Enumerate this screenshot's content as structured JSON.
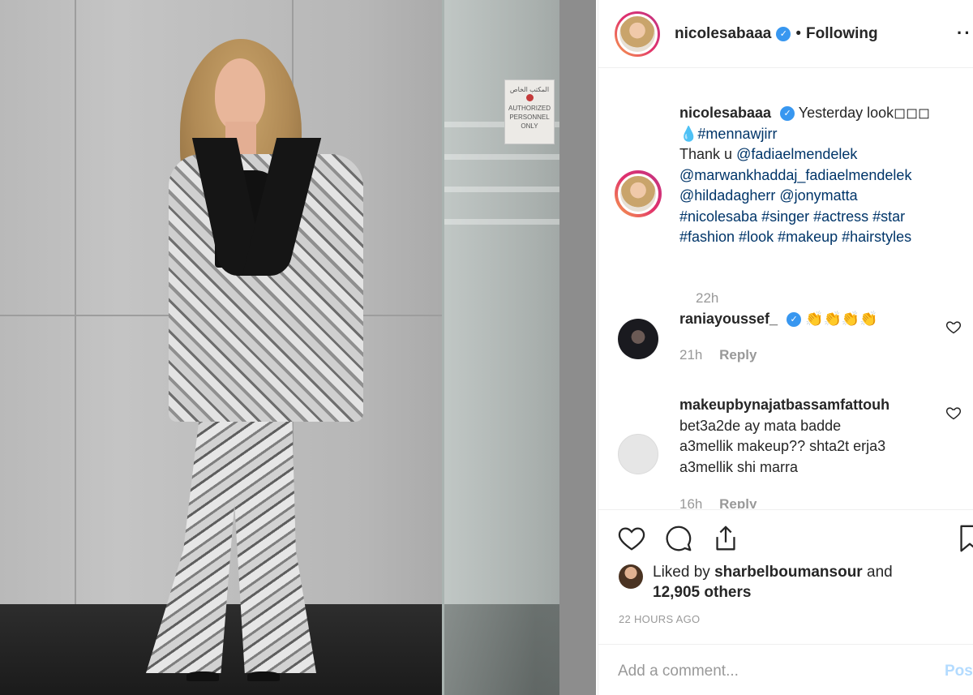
{
  "post": {
    "username": "nicolesabaaa",
    "verified_mark": "✓",
    "separator": "•",
    "follow_status": "Following",
    "more_icon": "···"
  },
  "caption": {
    "username": "nicolesabaaa",
    "line1": "Yesterday look◻◻◻",
    "line2_emoji": "💧",
    "line2_tag": "#mennawjirr",
    "thank": "Thank u",
    "mention1": "@fadiaelmendelek",
    "mention2": "@marwankhaddaj_fadiaelmendelek",
    "mention3": "@hildadagherr",
    "mention4": "@jonymatta",
    "tags1": "#nicolesaba #singer #actress #star",
    "tags2": "#fashion #look #makeup #hairstyles",
    "time": "22h"
  },
  "comments": [
    {
      "username": "raniayoussef_",
      "text": "👏👏👏👏",
      "time": "21h",
      "reply": "Reply"
    },
    {
      "username": "makeupbynajatbassamfattouh",
      "line1": "bet3a2de ay mata badde",
      "line2": "a3mellik makeup?? shta2t erja3",
      "line3": "a3mellik shi marra",
      "time": "16h",
      "reply": "Reply"
    }
  ],
  "likes": {
    "prefix": "Liked by",
    "user": "sharbelboumansour",
    "and": "and",
    "count": "12,905 others"
  },
  "timestamp": "22 HOURS AGO",
  "add_comment": {
    "placeholder": "Add a comment...",
    "post_label": "Post"
  },
  "sign": {
    "line1": "المكتب الخاص",
    "line2": "AUTHORIZED",
    "line3": "PERSONNEL ONLY"
  },
  "colors": {
    "accent": "#3897f0",
    "link": "#003569",
    "muted": "#999999"
  }
}
